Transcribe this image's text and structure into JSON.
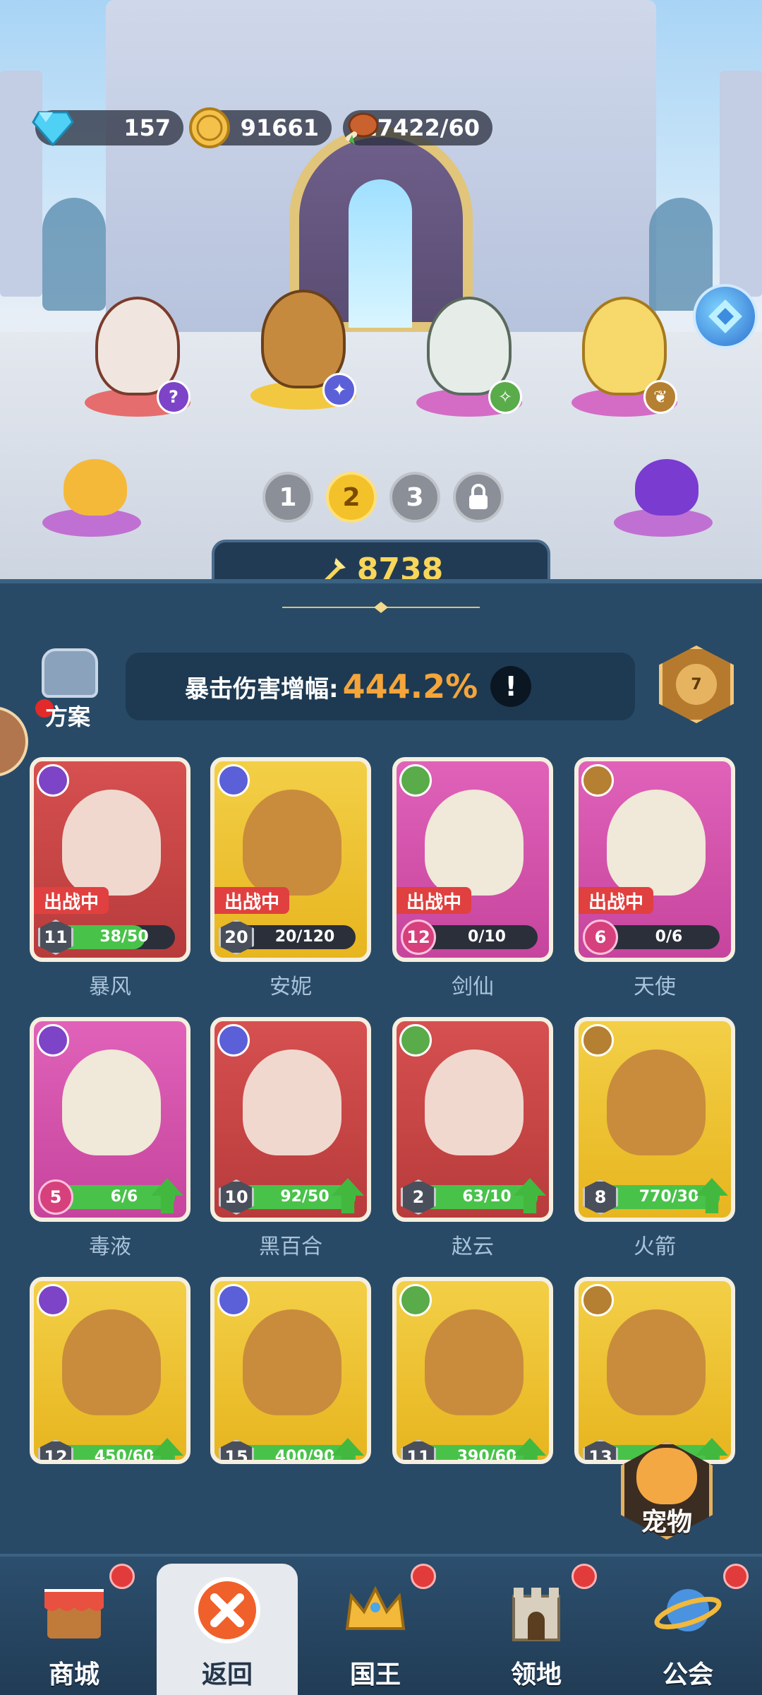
{
  "resources": {
    "gems": "157",
    "gold": "91661",
    "stamina": "17422/60"
  },
  "formation": {
    "pages": [
      "1",
      "2",
      "3"
    ],
    "active_page": "2",
    "locked_page_icon": "lock-icon"
  },
  "power": {
    "value": "8738"
  },
  "plan": {
    "label": "方案"
  },
  "bonus": {
    "label": "暴击伤害增幅:",
    "value": "444.2%",
    "info": "!"
  },
  "rank": {
    "value": "7"
  },
  "heroes": [
    {
      "name": "暴风",
      "level": "11",
      "progress": "38/50",
      "progress_ratio": 0.76,
      "deployed": true,
      "deploy_label": "出战中",
      "color": "red",
      "can_upgrade": false
    },
    {
      "name": "安妮",
      "level": "20",
      "progress": "20/120",
      "progress_ratio": 0.17,
      "deployed": true,
      "deploy_label": "出战中",
      "color": "gold",
      "can_upgrade": false
    },
    {
      "name": "剑仙",
      "level": "12",
      "progress": "0/10",
      "progress_ratio": 0,
      "deployed": true,
      "deploy_label": "出战中",
      "color": "pink",
      "can_upgrade": false
    },
    {
      "name": "天使",
      "level": "6",
      "progress": "0/6",
      "progress_ratio": 0,
      "deployed": true,
      "deploy_label": "出战中",
      "color": "pink",
      "can_upgrade": false
    },
    {
      "name": "毒液",
      "level": "5",
      "progress": "6/6",
      "progress_ratio": 1,
      "deployed": false,
      "color": "pink",
      "can_upgrade": true
    },
    {
      "name": "黑百合",
      "level": "10",
      "progress": "92/50",
      "progress_ratio": 1,
      "deployed": false,
      "color": "red",
      "can_upgrade": true
    },
    {
      "name": "赵云",
      "level": "2",
      "progress": "63/10",
      "progress_ratio": 1,
      "deployed": false,
      "color": "red",
      "can_upgrade": true
    },
    {
      "name": "火箭",
      "level": "8",
      "progress": "770/30",
      "progress_ratio": 1,
      "deployed": false,
      "color": "gold",
      "can_upgrade": true
    },
    {
      "name": "",
      "level": "12",
      "progress": "450/60",
      "progress_ratio": 1,
      "deployed": false,
      "color": "gold",
      "can_upgrade": true
    },
    {
      "name": "",
      "level": "15",
      "progress": "400/90",
      "progress_ratio": 1,
      "deployed": false,
      "color": "gold",
      "can_upgrade": true
    },
    {
      "name": "",
      "level": "11",
      "progress": "390/60",
      "progress_ratio": 1,
      "deployed": false,
      "color": "gold",
      "can_upgrade": true
    },
    {
      "name": "",
      "level": "13",
      "progress": "",
      "progress_ratio": 1,
      "deployed": false,
      "color": "gold",
      "can_upgrade": true
    }
  ],
  "pet": {
    "label": "宠物"
  },
  "nav": {
    "shop": "商城",
    "back": "返回",
    "king": "国王",
    "territory": "领地",
    "guild": "公会"
  },
  "colors": {
    "red_card": "#d65050",
    "gold_card": "#f3cf47",
    "pink_card": "#e062b9",
    "accent_orange": "#f5a53a",
    "power_yellow": "#f7d65a"
  }
}
